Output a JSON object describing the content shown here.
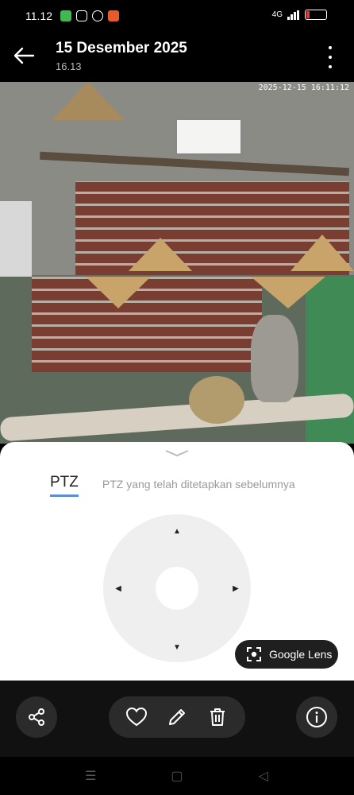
{
  "status_bar": {
    "time": "11.12",
    "icons": [
      "chat-notification-icon",
      "instagram-icon",
      "sync-icon",
      "app-notification-icon"
    ],
    "colors": {
      "chat": "#3fb950",
      "app": "#e85a2a",
      "battery_low": "#e53935"
    },
    "network_text": "4G"
  },
  "header": {
    "title": "15 Desember 2025",
    "subtitle": "16.13"
  },
  "camera": {
    "timestamp": "2025-12-15 16:11:12"
  },
  "sheet": {
    "tabs": [
      {
        "label": "PTZ",
        "active": true
      },
      {
        "label": "PTZ yang telah ditetapkan sebelumnya",
        "active": false
      }
    ],
    "accent_color": "#5b8dd9",
    "arrows": {
      "up": "▲",
      "down": "▼",
      "left": "◀",
      "right": "▶"
    }
  },
  "google_lens": {
    "label": "Google Lens"
  },
  "actions": [
    "share-icon",
    "favorite-icon",
    "edit-icon",
    "delete-icon",
    "info-icon"
  ],
  "nav": {
    "recents": "☰",
    "home": "▢",
    "back": "◁"
  }
}
